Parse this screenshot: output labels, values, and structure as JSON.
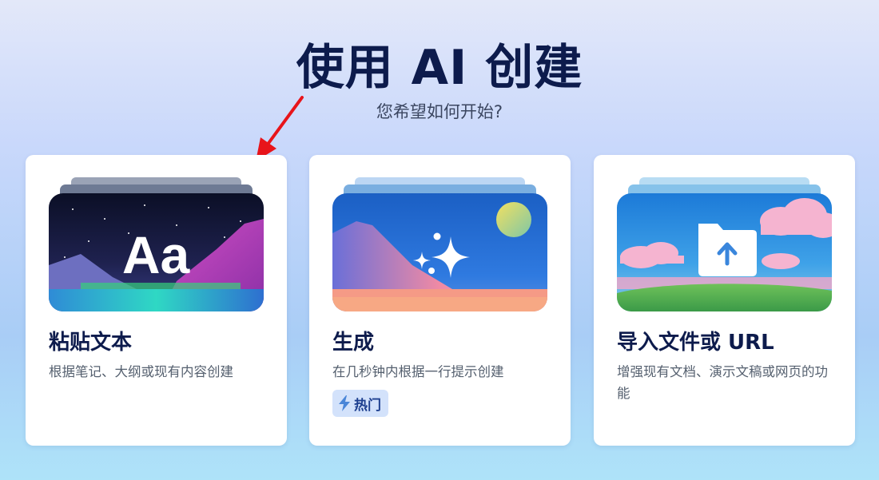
{
  "header": {
    "title": "使用 AI 创建",
    "subtitle": "您希望如何开始?"
  },
  "colors": {
    "title": "#0d1b4c",
    "annotation_arrow": "#e8141a",
    "badge_bg": "#d3e2fb",
    "badge_text": "#1d3f8f"
  },
  "cards": [
    {
      "title": "粘贴文本",
      "description": "根据笔记、大纲或现有内容创建",
      "thumbnail_text": "Aa",
      "thumbnail_icon": "text-aa-icon"
    },
    {
      "title": "生成",
      "description": "在几秒钟内根据一行提示创建",
      "thumbnail_icon": "sparkles-icon",
      "badge": {
        "icon": "lightning-icon",
        "label": "热门"
      }
    },
    {
      "title": "导入文件或 URL",
      "description": "增强现有文档、演示文稿或网页的功能",
      "thumbnail_icon": "upload-folder-icon"
    }
  ]
}
